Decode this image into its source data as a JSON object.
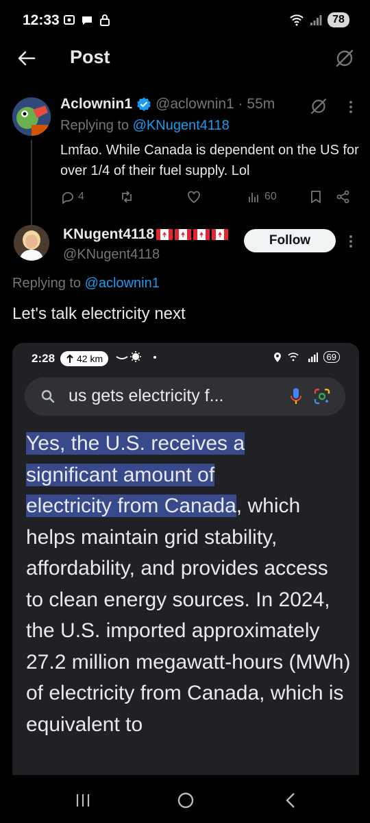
{
  "status_bar": {
    "time": "12:33",
    "battery": "78"
  },
  "header": {
    "title": "Post"
  },
  "tweet1": {
    "display_name": "Aclownin1",
    "handle_time": "@aclownin1 · 55m",
    "replying_prefix": "Replying to ",
    "replying_to": "@KNugent4118",
    "body": "Lmfao. While Canada is dependent on the US for over 1/4 of their fuel supply. Lol",
    "reply_count": "4",
    "view_count": "60"
  },
  "tweet2": {
    "display_name": "KNugent4118",
    "handle": "@KNugent4118",
    "follow_label": "Follow",
    "replying_prefix": "Replying to ",
    "replying_to": "@aclownin1",
    "body": "Let's talk electricity next"
  },
  "embedded": {
    "time": "2:28",
    "distance": "42 km",
    "battery": "69",
    "search_query": "us gets electricity f...",
    "answer_highlight_1": "Yes, the U.S. receives a",
    "answer_highlight_2": "significant amount of",
    "answer_highlight_3": "electricity from Canada",
    "answer_rest": ", which helps maintain grid stability, affordability, and provides access to clean energy sources. In 2024, the U.S. imported approximately 27.2 million megawatt-hours (MWh) of electricity from Canada, which is equivalent to"
  },
  "colors": {
    "accent": "#1d9bf0",
    "muted": "#71767b",
    "highlight": "#394a8c"
  }
}
